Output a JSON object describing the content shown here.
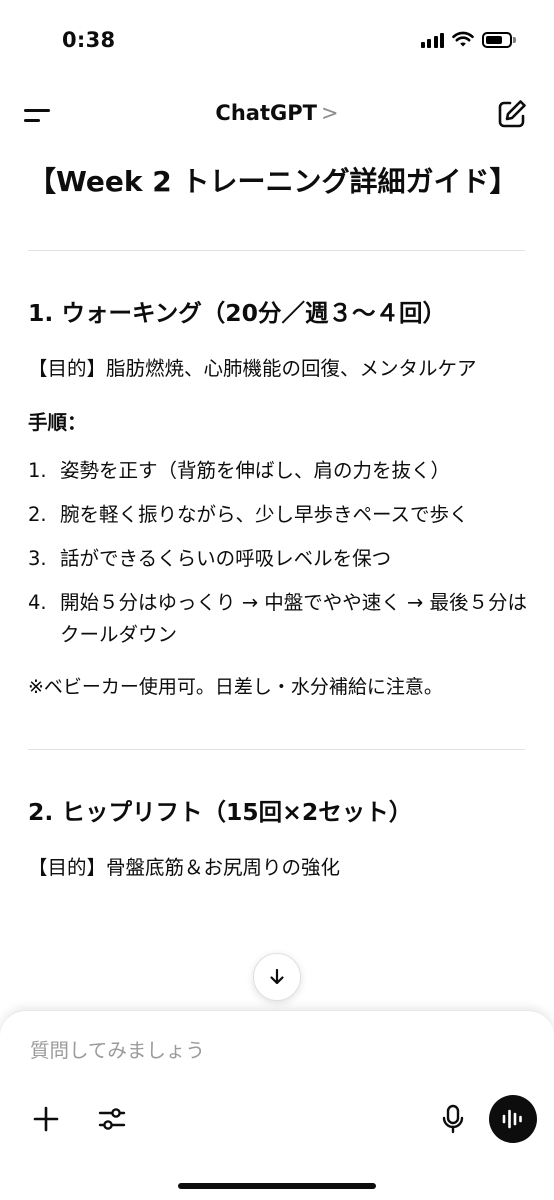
{
  "status_bar": {
    "time": "0:38"
  },
  "header": {
    "title": "ChatGPT",
    "chevron": ">"
  },
  "content": {
    "title": "【Week 2 トレーニング詳細ガイド】",
    "sections": [
      {
        "heading": "1. ウォーキング（20分／週３〜４回）",
        "purpose": "【目的】脂肪燃焼、心肺機能の回復、メンタルケア",
        "steps_label": "手順：",
        "steps": [
          {
            "num": "1.",
            "text": "姿勢を正す（背筋を伸ばし、肩の力を抜く）"
          },
          {
            "num": "2.",
            "text": "腕を軽く振りながら、少し早歩きペースで歩く"
          },
          {
            "num": "3.",
            "text": "話ができるくらいの呼吸レベルを保つ"
          },
          {
            "num": "4.",
            "text": "開始５分はゆっくり → 中盤でやや速く → 最後５分はクールダウン"
          }
        ],
        "note": "※ベビーカー使用可。日差し・水分補給に注意。"
      },
      {
        "heading": "2. ヒップリフト（15回×2セット）",
        "purpose": "【目的】骨盤底筋＆お尻周りの強化"
      }
    ]
  },
  "composer": {
    "placeholder": "質問してみましょう"
  },
  "icons": {
    "menu": "menu-icon",
    "new_chat": "new-chat-icon",
    "scroll_down": "arrow-down-icon",
    "plus": "plus-icon",
    "tools": "sliders-icon",
    "mic": "microphone-icon",
    "voice": "voice-waveform-icon"
  }
}
